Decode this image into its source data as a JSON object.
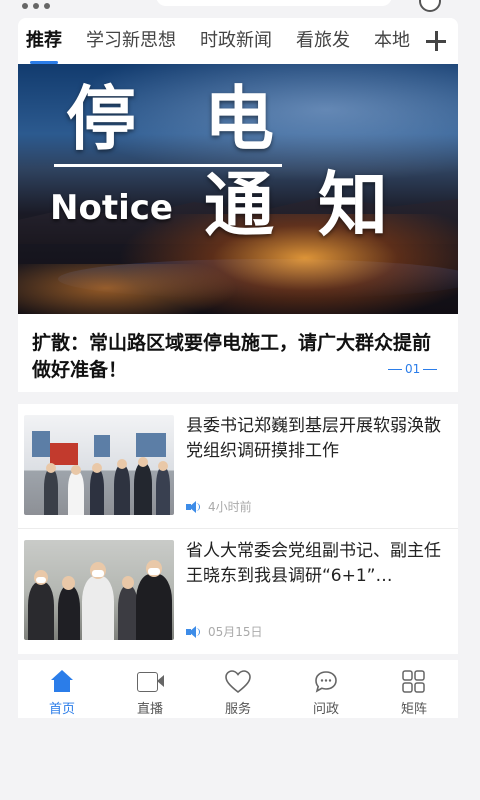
{
  "tabs": {
    "items": [
      {
        "label": "推荐",
        "active": true
      },
      {
        "label": "学习新思想",
        "active": false
      },
      {
        "label": "时政新闻",
        "active": false
      },
      {
        "label": "看旅发",
        "active": false
      },
      {
        "label": "本地",
        "active": false
      }
    ],
    "add_icon": "plus-icon"
  },
  "banner": {
    "image_text": {
      "line1_char1": "停",
      "line1_char2": "电",
      "notice": "Notice",
      "line2_char1": "通",
      "line2_char2": "知"
    },
    "headline": "扩散：常山路区域要停电施工，请广大群众提前做好准备！",
    "page_indicator": "01"
  },
  "news": [
    {
      "title": "县委书记郑巍到基层开展软弱涣散党组织调研摸排工作",
      "time": "4小时前",
      "icon": "speaker-icon"
    },
    {
      "title": "省人大常委会党组副书记、副主任王晓东到我县调研“6+1”…",
      "time": "05月15日",
      "icon": "speaker-icon"
    }
  ],
  "bottom_nav": [
    {
      "label": "首页",
      "icon": "home-icon",
      "active": true
    },
    {
      "label": "直播",
      "icon": "live-camera-icon",
      "active": false
    },
    {
      "label": "服务",
      "icon": "heart-service-icon",
      "active": false
    },
    {
      "label": "问政",
      "icon": "chat-bubble-icon",
      "active": false
    },
    {
      "label": "矩阵",
      "icon": "grid-icon",
      "active": false
    }
  ],
  "colors": {
    "accent": "#2b7de9",
    "background": "#f3f3f5"
  }
}
